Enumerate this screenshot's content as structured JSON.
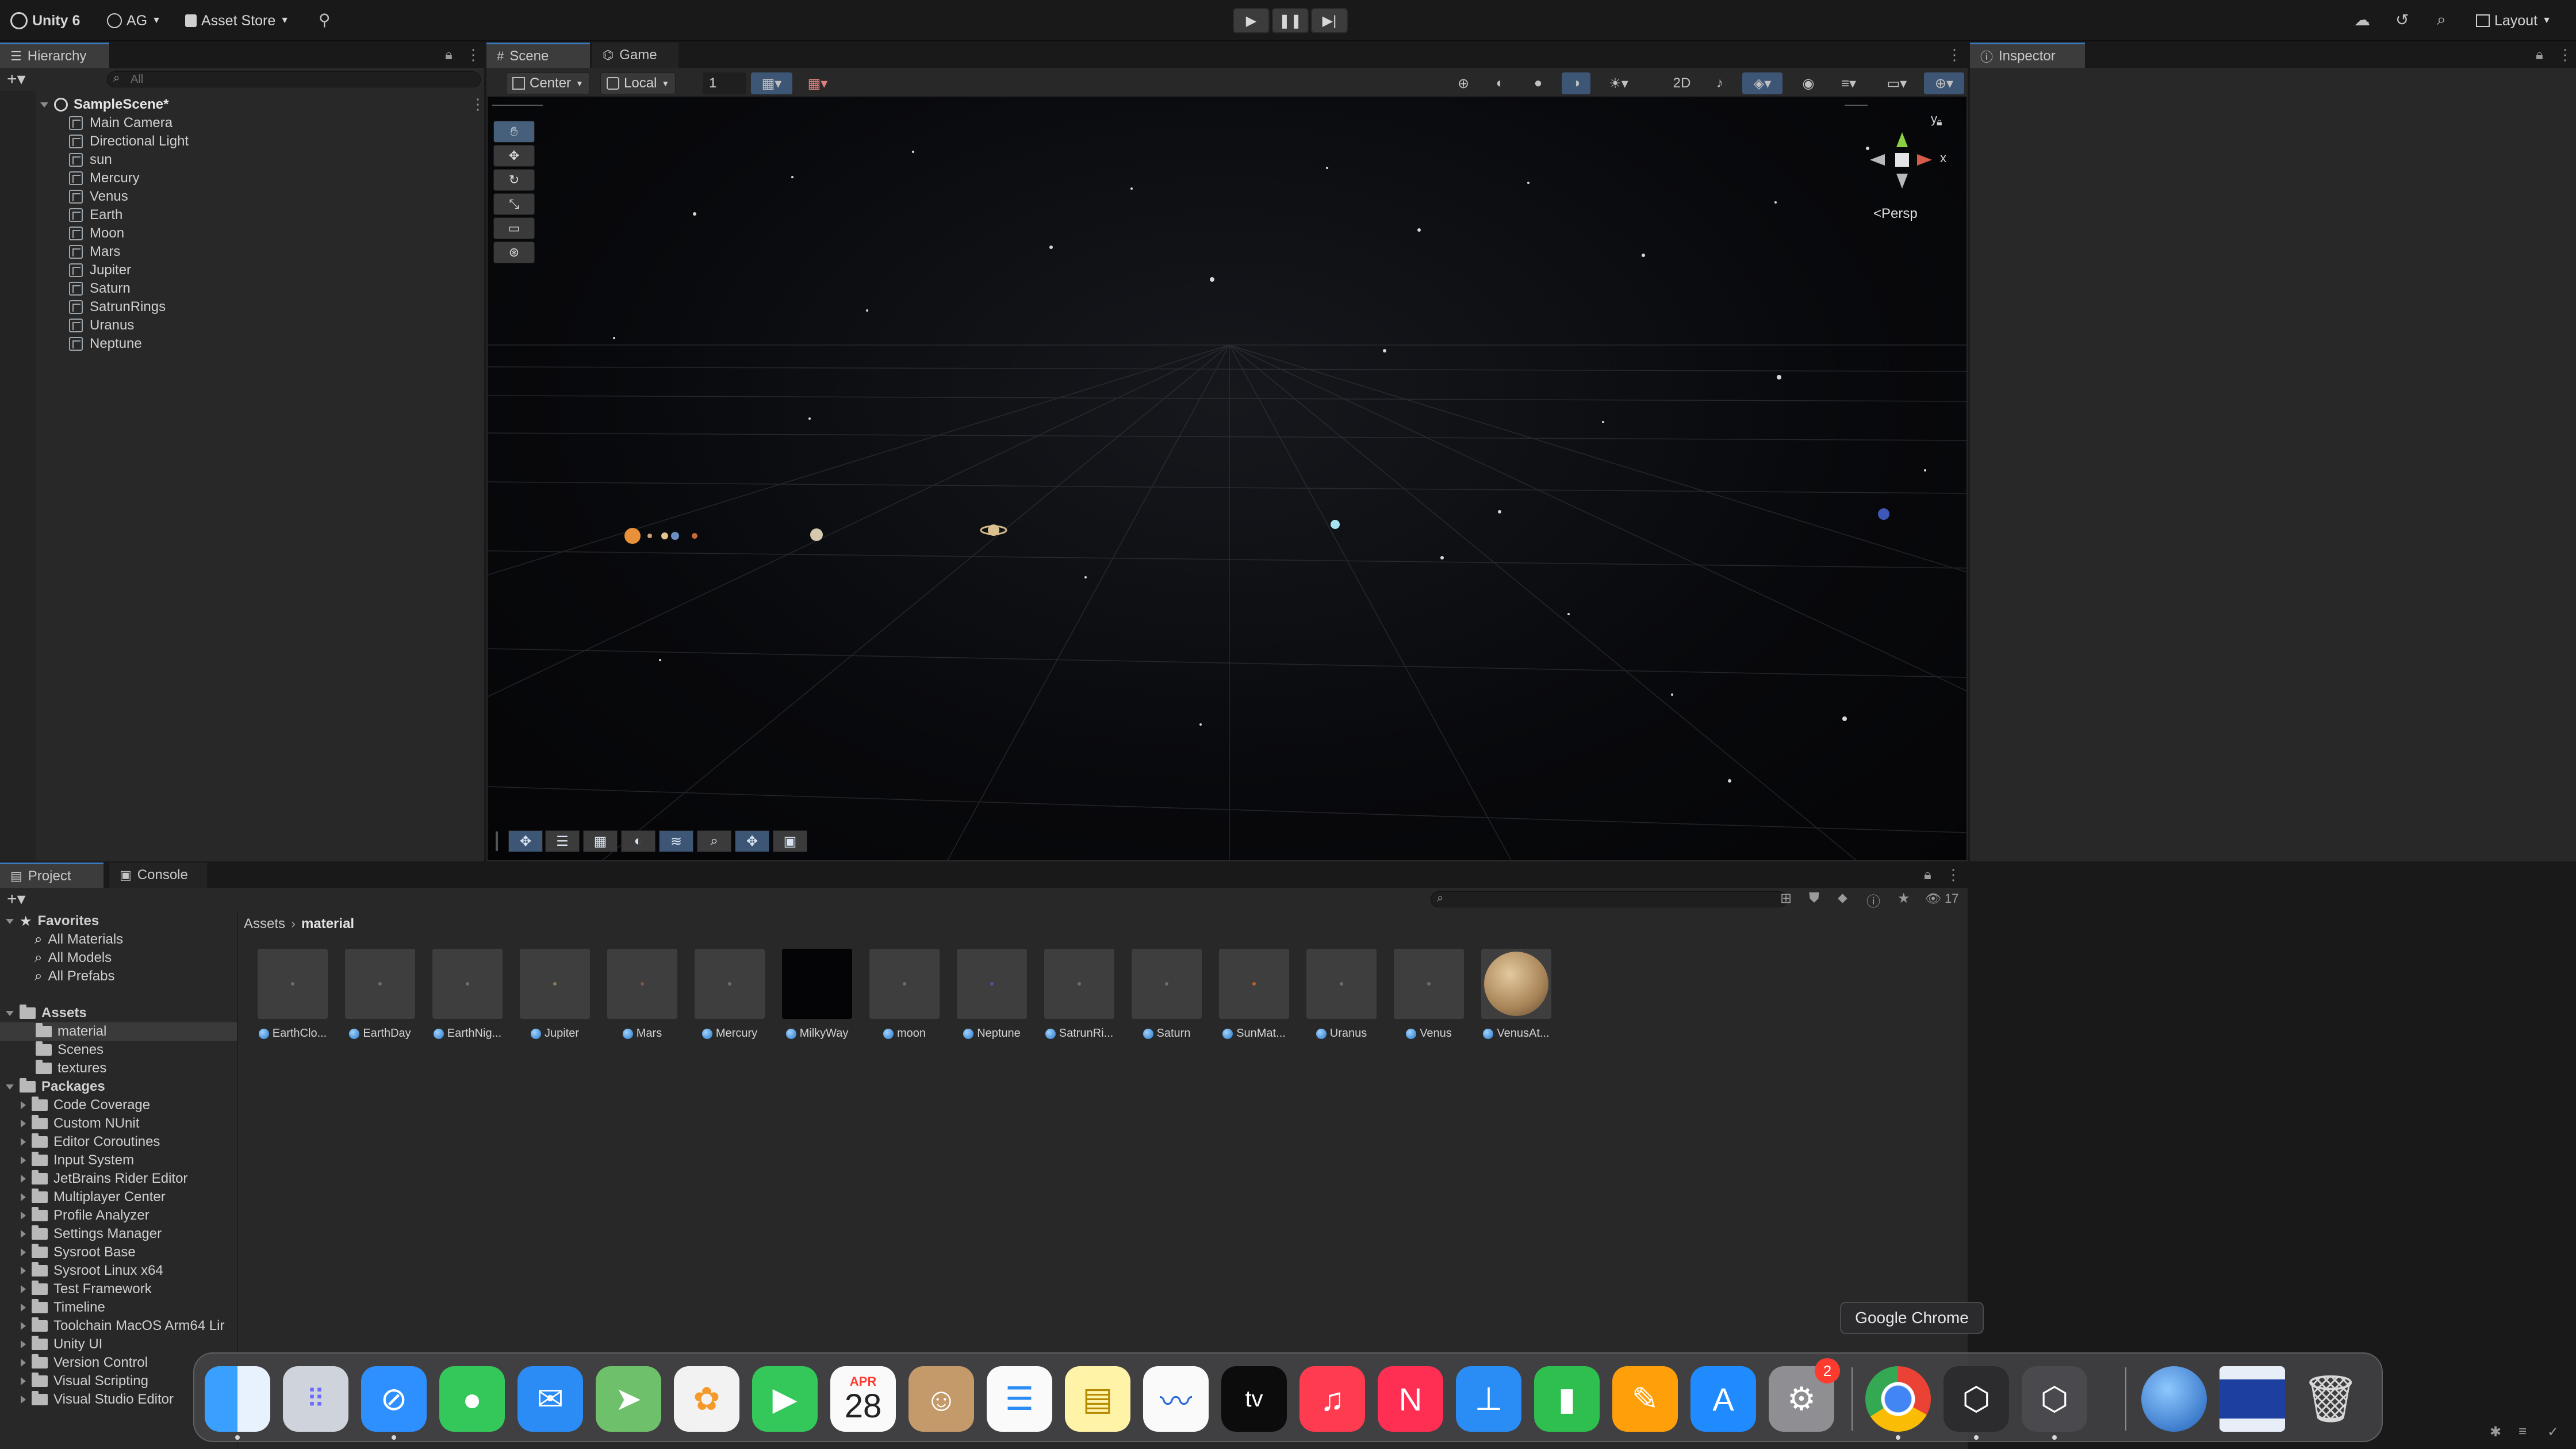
{
  "toolbar": {
    "unity_label": "Unity 6",
    "account_label": "AG",
    "asset_store_label": "Asset Store",
    "layout_label": "Layout"
  },
  "hierarchy": {
    "tab_label": "Hierarchy",
    "search_placeholder": "All",
    "scene_name": "SampleScene*",
    "items": [
      "Main Camera",
      "Directional Light",
      "sun",
      "Mercury",
      "Venus",
      "Earth",
      "Moon",
      "Mars",
      "Jupiter",
      "Saturn",
      "SatrunRings",
      "Uranus",
      "Neptune"
    ]
  },
  "scene": {
    "tab_scene": "Scene",
    "tab_game": "Game",
    "pivot_label": "Center",
    "space_label": "Local",
    "grid_value": "1",
    "persp_label": "<Persp",
    "gizmo_y": "y",
    "gizmo_x": "x"
  },
  "inspector": {
    "tab_label": "Inspector"
  },
  "project": {
    "tab_project": "Project",
    "tab_console": "Console",
    "hidden_count": "17",
    "breadcrumb_root": "Assets",
    "breadcrumb_current": "material",
    "favorites_label": "Favorites",
    "favorites": [
      "All Materials",
      "All Models",
      "All Prefabs"
    ],
    "assets_label": "Assets",
    "asset_folders": [
      "material",
      "Scenes",
      "textures"
    ],
    "packages_label": "Packages",
    "packages": [
      "Code Coverage",
      "Custom NUnit",
      "Editor Coroutines",
      "Input System",
      "JetBrains Rider Editor",
      "Multiplayer Center",
      "Profile Analyzer",
      "Settings Manager",
      "Sysroot Base",
      "Sysroot Linux x64",
      "Test Framework",
      "Timeline",
      "Toolchain MacOS Arm64 Lir",
      "Unity UI",
      "Version Control",
      "Visual Scripting",
      "Visual Studio Editor"
    ],
    "assets": [
      "EarthClo...",
      "EarthDay",
      "EarthNig...",
      "Jupiter",
      "Mars",
      "Mercury",
      "MilkyWay",
      "moon",
      "Neptune",
      "SatrunRi...",
      "Saturn",
      "SunMat...",
      "Uranus",
      "Venus",
      "VenusAt..."
    ]
  },
  "dock": {
    "tooltip": "Google Chrome",
    "calendar_month": "APR",
    "calendar_day": "28",
    "settings_badge": "2",
    "apps": [
      "finder-icon",
      "launchpad-icon",
      "safari-icon",
      "messages-icon",
      "mail-icon",
      "maps-icon",
      "photos-icon",
      "facetime-icon",
      "calendar-icon",
      "contacts-icon",
      "reminders-icon",
      "notes-icon",
      "freeform-icon",
      "tv-icon",
      "music-icon",
      "news-icon",
      "keynote-icon",
      "numbers-icon",
      "pages-icon",
      "app-store-icon",
      "system-settings-icon",
      "chrome-icon",
      "unity-hub-icon",
      "unity-6-icon",
      "globe-icon",
      "screen-icon",
      "trash-icon"
    ]
  },
  "colors": {
    "accent": "#3a79bb",
    "panel": "#282828",
    "background": "#191919"
  }
}
